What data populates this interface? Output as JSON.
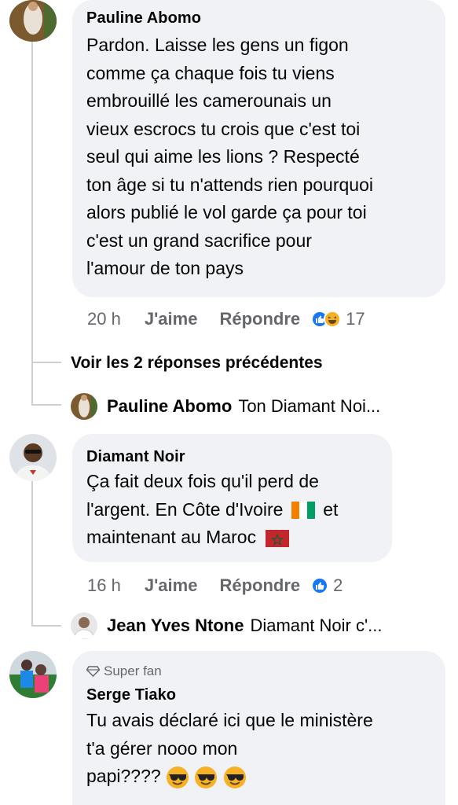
{
  "comments": [
    {
      "author": "Pauline Abomo",
      "text_lines": [
        "Pardon. Laisse les gens un figon",
        "comme ça chaque fois tu viens",
        "embrouillé les camerounais un",
        "vieux escrocs tu crois que c'est toi",
        "seul qui aime les lions ? Respecté",
        "ton âge si tu n'attends rien pourquoi",
        "alors publié le vol garde ça pour toi",
        "c'est un grand sacrifice pour",
        "l'amour de ton pays"
      ],
      "time": "20 h",
      "like_label": "J'aime",
      "reply_label": "Répondre",
      "reaction_count": "17",
      "reaction_icons": [
        "like-icon",
        "laugh-emoji-icon"
      ]
    },
    {
      "author": "Diamant Noir",
      "text_lines": [
        "Ça fait deux fois qu'il perd de",
        "l'argent. En Côte d'Ivoire",
        "maintenant au Maroc"
      ],
      "inline_after_line2": "et",
      "time": "16 h",
      "like_label": "J'aime",
      "reply_label": "Répondre",
      "reaction_count": "2",
      "reaction_icons": [
        "like-icon"
      ]
    },
    {
      "badge": "Super fan",
      "author": "Serge Tiako",
      "text_lines": [
        "Tu avais déclaré ici que le ministère",
        "t'a gérer nooo mon",
        "papi????"
      ]
    }
  ],
  "view_previous": "Voir les 2 réponses précédentes",
  "replies": [
    {
      "author": "Pauline Abomo",
      "text": "Ton Diamant Noi..."
    },
    {
      "author": "Jean Yves Ntone",
      "text": "Diamant Noir c'..."
    }
  ],
  "colors": {
    "bubble": "#f0f2f5",
    "meta_text": "#65676b",
    "like_blue": "#1877f2",
    "thread_line": "#ccd0d5"
  }
}
